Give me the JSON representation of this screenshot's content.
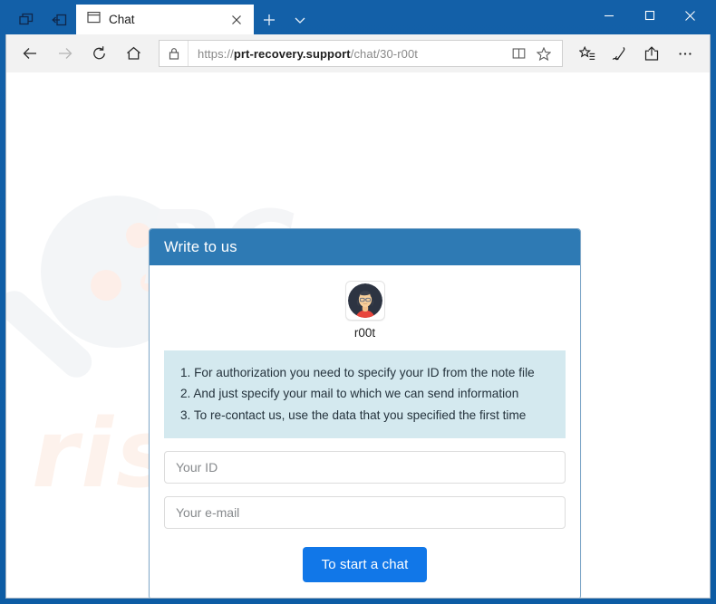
{
  "window": {
    "title": "Chat",
    "controls": {
      "minimize": "Minimize",
      "maximize": "Maximize",
      "close": "Close"
    },
    "system_icons": {
      "show_tabs": "show-tabs-you-have-set-aside-icon",
      "set_tabs_aside": "set-these-tabs-aside-icon"
    }
  },
  "tabstrip": {
    "tabs": [
      {
        "title": "Chat",
        "favicon": "page-icon",
        "close_label": "×"
      }
    ],
    "new_tab_label": "+",
    "tab_dropdown_label": "∨"
  },
  "toolbar": {
    "back_label": "←",
    "forward_label": "→",
    "refresh_label": "↻",
    "home_label": "⌂",
    "reading_view_label": "Reading view",
    "favorite_label": "Add to favorites",
    "hub_label": "Hub (favorites, reading list, history, downloads)",
    "notes_label": "Make a Web Note",
    "share_label": "Share",
    "more_label": "Settings and more"
  },
  "address_bar": {
    "scheme": "https://",
    "domain": "prt-recovery.support",
    "path": "/chat/30-r00t",
    "full_url": "https://prt-recovery.support/chat/30-r00t",
    "lock_icon": "padlock-icon"
  },
  "page": {
    "watermark_top": "PC",
    "watermark_bottom": "risk.com",
    "card": {
      "header_title": "Write to us",
      "agent": {
        "avatar_icon": "operator-avatar-icon",
        "name": "r00t"
      },
      "instructions": [
        "1. For authorization you need to specify your ID from the note file",
        "2. And just specify your mail to which we can send information",
        "3. To re-contact us, use the data that you specified the first time"
      ],
      "fields": [
        {
          "name": "id",
          "placeholder": "Your ID",
          "value": ""
        },
        {
          "name": "email",
          "placeholder": "Your e-mail",
          "value": ""
        }
      ],
      "submit_label": "To start a chat"
    }
  },
  "colors": {
    "window_frame": "#0d5ca4",
    "card_header": "#2e7ab4",
    "instruction_box": "#d4e9ef",
    "button": "#1177e8",
    "card_border": "#7fa8c9"
  }
}
